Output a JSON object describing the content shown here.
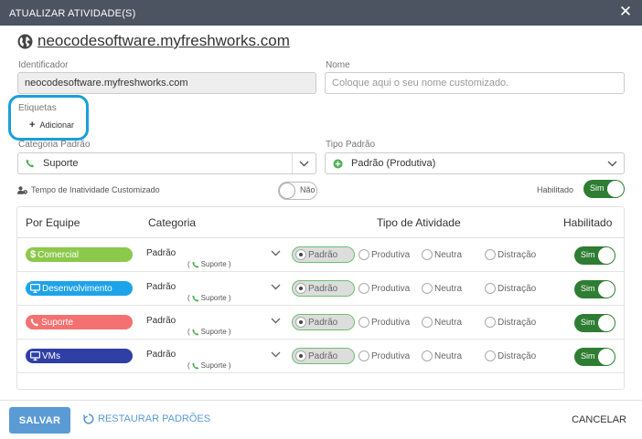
{
  "dialog": {
    "title": "ATUALIZAR ATIVIDADE(S)",
    "close_glyph": "✕"
  },
  "domain": {
    "icon": "globe-icon",
    "text": "neocodesoftware.myfreshworks.com"
  },
  "form": {
    "identifier_label": "Identificador",
    "identifier_value": "neocodesoftware.myfreshworks.com",
    "name_label": "Nome",
    "name_placeholder": "Coloque aqui o seu nome customizado.",
    "tags_label": "Etiquetas",
    "add_tag_label": "Adicionar",
    "default_category_label": "Categoria Padrão",
    "default_category_value": "Suporte",
    "default_type_label": "Tipo Padrão",
    "default_type_value": "Padrão (Produtiva)",
    "custom_idle_label": "Tempo de Inatividade Customizado",
    "custom_idle_toggle": "Não",
    "enabled_label": "Habilitado",
    "enabled_toggle": "Sim"
  },
  "table": {
    "headers": {
      "team": "Por Equipe",
      "category": "Categoria",
      "activity_type": "Tipo de Atividade",
      "enabled": "Habilitado"
    },
    "rows": [
      {
        "team": "Comercial",
        "team_icon": "dollar-icon",
        "team_color": "#8cc84b",
        "category": "Padrão",
        "subcategory": "Suporte",
        "options": [
          "Padrão",
          "Produtiva",
          "Neutra",
          "Distração"
        ],
        "selected": "Padrão",
        "enabled": "Sim"
      },
      {
        "team": "Desenvolvimento",
        "team_icon": "monitor-icon",
        "team_color": "#1ea3e8",
        "category": "Padrão",
        "subcategory": "Suporte",
        "options": [
          "Padrão",
          "Produtiva",
          "Neutra",
          "Distração"
        ],
        "selected": "Padrão",
        "enabled": "Sim"
      },
      {
        "team": "Suporte",
        "team_icon": "phone-icon",
        "team_color": "#f47171",
        "category": "Padrão",
        "subcategory": "Suporte",
        "options": [
          "Padrão",
          "Produtiva",
          "Neutra",
          "Distração"
        ],
        "selected": "Padrão",
        "enabled": "Sim"
      },
      {
        "team": "VMs",
        "team_icon": "monitor-icon",
        "team_color": "#2f3fa6",
        "category": "Padrão",
        "subcategory": "Suporte",
        "options": [
          "Padrão",
          "Produtiva",
          "Neutra",
          "Distração"
        ],
        "selected": "Padrão",
        "enabled": "Sim"
      }
    ]
  },
  "footer": {
    "save_label": "SALVAR",
    "restore_label": "RESTAURAR PADRÕES",
    "cancel_label": "CANCELAR"
  },
  "colors": {
    "titlebar": "#4c5361",
    "accent_blue": "#5b9bd5",
    "toggle_green": "#2e7d32",
    "highlight": "#1b9fd9",
    "phone_green": "#4caf50"
  }
}
